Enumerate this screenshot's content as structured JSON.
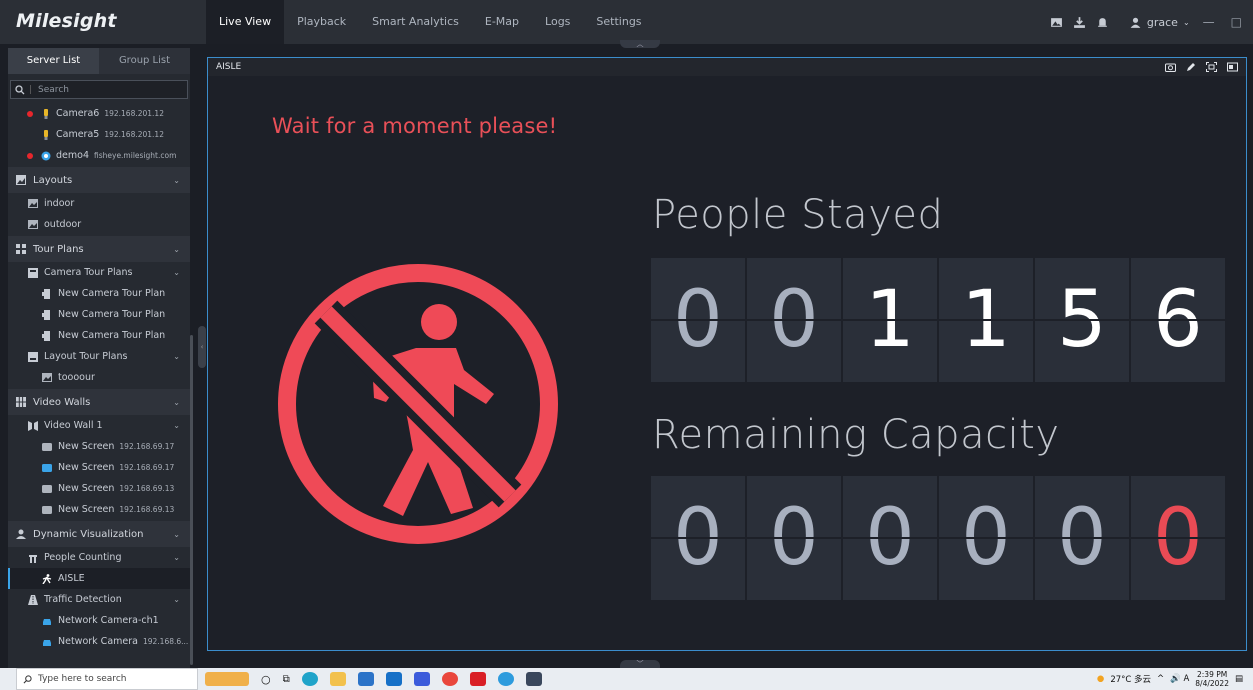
{
  "app": {
    "brand": "Milesight"
  },
  "nav": {
    "items": [
      "Live View",
      "Playback",
      "Smart Analytics",
      "E-Map",
      "Logs",
      "Settings"
    ],
    "active": "Live View"
  },
  "header": {
    "user": "grace"
  },
  "sidebar": {
    "tabs": [
      "Server List",
      "Group List"
    ],
    "search_placeholder": "Search",
    "devices": [
      {
        "name": "Camera6",
        "ip": "192.168.201.12"
      },
      {
        "name": "Camera5",
        "ip": "192.168.201.12"
      },
      {
        "name": "demo4",
        "ip": "fisheye.milesight.com"
      }
    ],
    "layouts": {
      "label": "Layouts",
      "items": [
        "indoor",
        "outdoor"
      ]
    },
    "tour_plans": {
      "label": "Tour Plans",
      "camera_tour": {
        "label": "Camera Tour Plans",
        "items": [
          "New Camera Tour Plan",
          "New Camera Tour Plan",
          "New Camera Tour Plan"
        ]
      },
      "layout_tour": {
        "label": "Layout Tour Plans",
        "items": [
          "toooour"
        ]
      }
    },
    "video_walls": {
      "label": "Video Walls",
      "wall": {
        "label": "Video Wall 1",
        "screens": [
          {
            "name": "New Screen",
            "ip": "192.168.69.17"
          },
          {
            "name": "New Screen",
            "ip": "192.168.69.17"
          },
          {
            "name": "New Screen",
            "ip": "192.168.69.13"
          },
          {
            "name": "New Screen",
            "ip": "192.168.69.13"
          }
        ]
      }
    },
    "dynamic": {
      "label": "Dynamic Visualization",
      "people_counting": {
        "label": "People Counting",
        "items": [
          "AISLE"
        ]
      },
      "traffic": {
        "label": "Traffic Detection",
        "items": [
          {
            "name": "Network Camera-ch1",
            "ip": ""
          },
          {
            "name": "Network Camera",
            "ip": "192.168.6..."
          }
        ]
      }
    }
  },
  "panel": {
    "title": "AISLE",
    "wait_message": "Wait for a moment please!",
    "people_stayed_label": "People Stayed",
    "people_stayed_digits": [
      "0",
      "0",
      "1",
      "1",
      "5",
      "6"
    ],
    "remaining_label": "Remaining Capacity",
    "remaining_digits": [
      "0",
      "0",
      "0",
      "0",
      "0",
      "0"
    ]
  },
  "taskbar": {
    "search_placeholder": "Type here to search",
    "weather": "27°C 多云",
    "time": "2:39 PM",
    "date": "8/4/2022"
  },
  "colors": {
    "alert": "#e94b55",
    "accent": "#3aa4e9",
    "panel_border": "#3b8dcc"
  }
}
